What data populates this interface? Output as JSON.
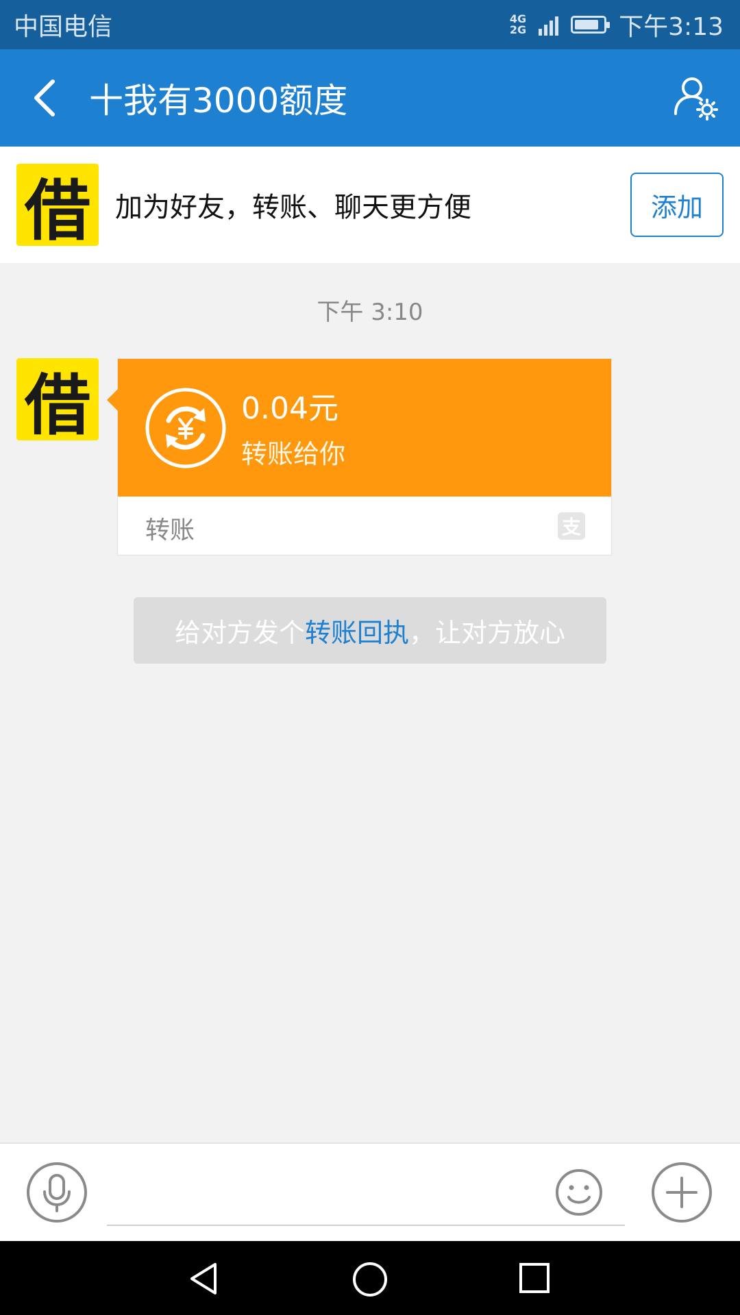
{
  "status_bar": {
    "carrier": "中国电信",
    "network_top": "4G",
    "network_bottom": "2G",
    "time": "下午3:13",
    "battery_level": 0.85
  },
  "header": {
    "title": "十我有3000额度"
  },
  "banner": {
    "logo_char": "借",
    "text": "加为好友，转账、聊天更方便",
    "add_label": "添加"
  },
  "chat": {
    "timestamp": "下午 3:10",
    "avatar_char": "借",
    "transfer": {
      "amount": "0.04元",
      "subtitle": "转账给你",
      "label": "转账",
      "brand_char": "支"
    },
    "tip": {
      "before": "给对方发个",
      "link": "转账回执",
      "after": "，让对方放心"
    }
  },
  "input": {
    "value": "",
    "placeholder": ""
  },
  "colors": {
    "status_bar": "#155f9c",
    "header": "#1e80d0",
    "transfer_orange": "#ff980d",
    "logo_yellow": "#ffe400"
  }
}
